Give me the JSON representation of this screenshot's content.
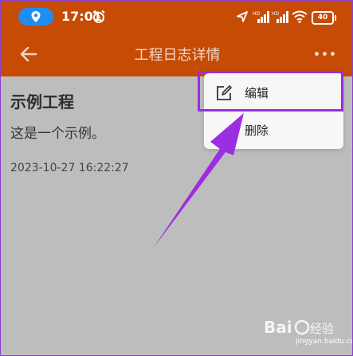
{
  "status_bar": {
    "time": "17:01",
    "battery": "40",
    "icons": [
      "location-icon",
      "alarm-icon",
      "navigation-icon",
      "signal-hd-icon",
      "signal-hd-icon",
      "wifi-icon",
      "battery-icon"
    ]
  },
  "app_bar": {
    "title": "工程日志详情",
    "back_icon": "arrow-left-icon",
    "more_icon": "more-horizontal-icon"
  },
  "record": {
    "title": "示例工程",
    "description": "这是一个示例。",
    "timestamp": "2023-10-27 16:22:27"
  },
  "menu": {
    "items": [
      {
        "label": "编辑",
        "icon": "edit-icon"
      },
      {
        "label": "删除"
      }
    ]
  },
  "annotation": {
    "highlight_color": "#9b2ee0",
    "arrow_color": "#9b2ee0"
  },
  "colors": {
    "app_bar": "#c64b05",
    "background": "#bdbdbd",
    "location_pill": "#1e8ef4"
  },
  "watermark": {
    "text": "jingyan.baidu.com"
  }
}
